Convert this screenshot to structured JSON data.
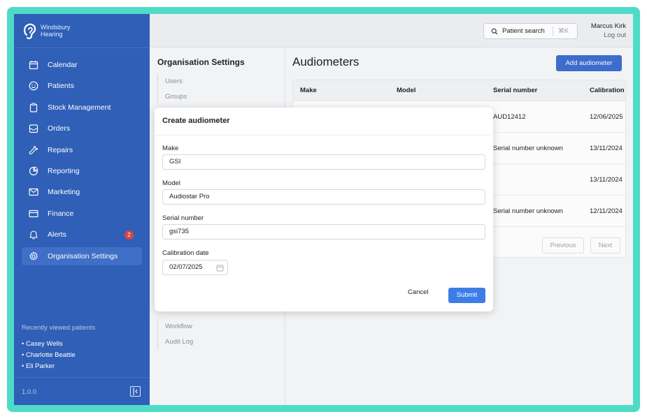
{
  "brand": {
    "name_line1": "Windsbury",
    "name_line2": "Hearing"
  },
  "sidebar": {
    "items": [
      {
        "label": "Calendar",
        "icon": "calendar-icon"
      },
      {
        "label": "Patients",
        "icon": "smiley-icon"
      },
      {
        "label": "Stock Management",
        "icon": "clipboard-icon"
      },
      {
        "label": "Orders",
        "icon": "inbox-icon"
      },
      {
        "label": "Repairs",
        "icon": "wrench-icon"
      },
      {
        "label": "Reporting",
        "icon": "pie-chart-icon"
      },
      {
        "label": "Marketing",
        "icon": "mail-icon"
      },
      {
        "label": "Finance",
        "icon": "credit-card-icon"
      },
      {
        "label": "Alerts",
        "icon": "bell-icon",
        "badge": "2"
      },
      {
        "label": "Organisation Settings",
        "icon": "gear-icon",
        "active": true
      }
    ],
    "recent_title": "Recently viewed patients",
    "recent": [
      "• Casey Wells",
      "• Charlotte Beattie",
      "• Eli Parker"
    ],
    "version": "1.0.0"
  },
  "topbar": {
    "search_label": "Patient search",
    "search_shortcut": "⌘K",
    "user_name": "Marcus Kirk",
    "logout_label": "Log out"
  },
  "settings": {
    "title": "Organisation Settings",
    "items_top": [
      "Users",
      "Groups"
    ],
    "items_bottom": [
      "Workflow",
      "Audit Log"
    ]
  },
  "main": {
    "title": "Audiometers",
    "add_label": "Add audiometer",
    "columns": [
      "Make",
      "Model",
      "Serial number",
      "Calibration"
    ],
    "rows": [
      {
        "serial": "AUD12412",
        "calibration": "12/06/2025"
      },
      {
        "serial": "Serial number unknown",
        "calibration": "13/11/2024"
      },
      {
        "serial": "",
        "calibration": "13/11/2024"
      },
      {
        "serial": "Serial number unknown",
        "calibration": "12/11/2024"
      }
    ],
    "previous_label": "Previous",
    "next_label": "Next"
  },
  "modal": {
    "title": "Create audiometer",
    "make_label": "Make",
    "make_value": "GSI",
    "model_label": "Model",
    "model_value": "Audiostar Pro",
    "serial_label": "Serial number",
    "serial_value": "gsi735",
    "date_label": "Calibration date",
    "date_value": "02/07/2025",
    "cancel_label": "Cancel",
    "submit_label": "Submit"
  },
  "colors": {
    "frame": "#4fdcc6",
    "sidebar": "#2f5fb7",
    "accent": "#3d6ed0",
    "badge": "#d7463f"
  }
}
